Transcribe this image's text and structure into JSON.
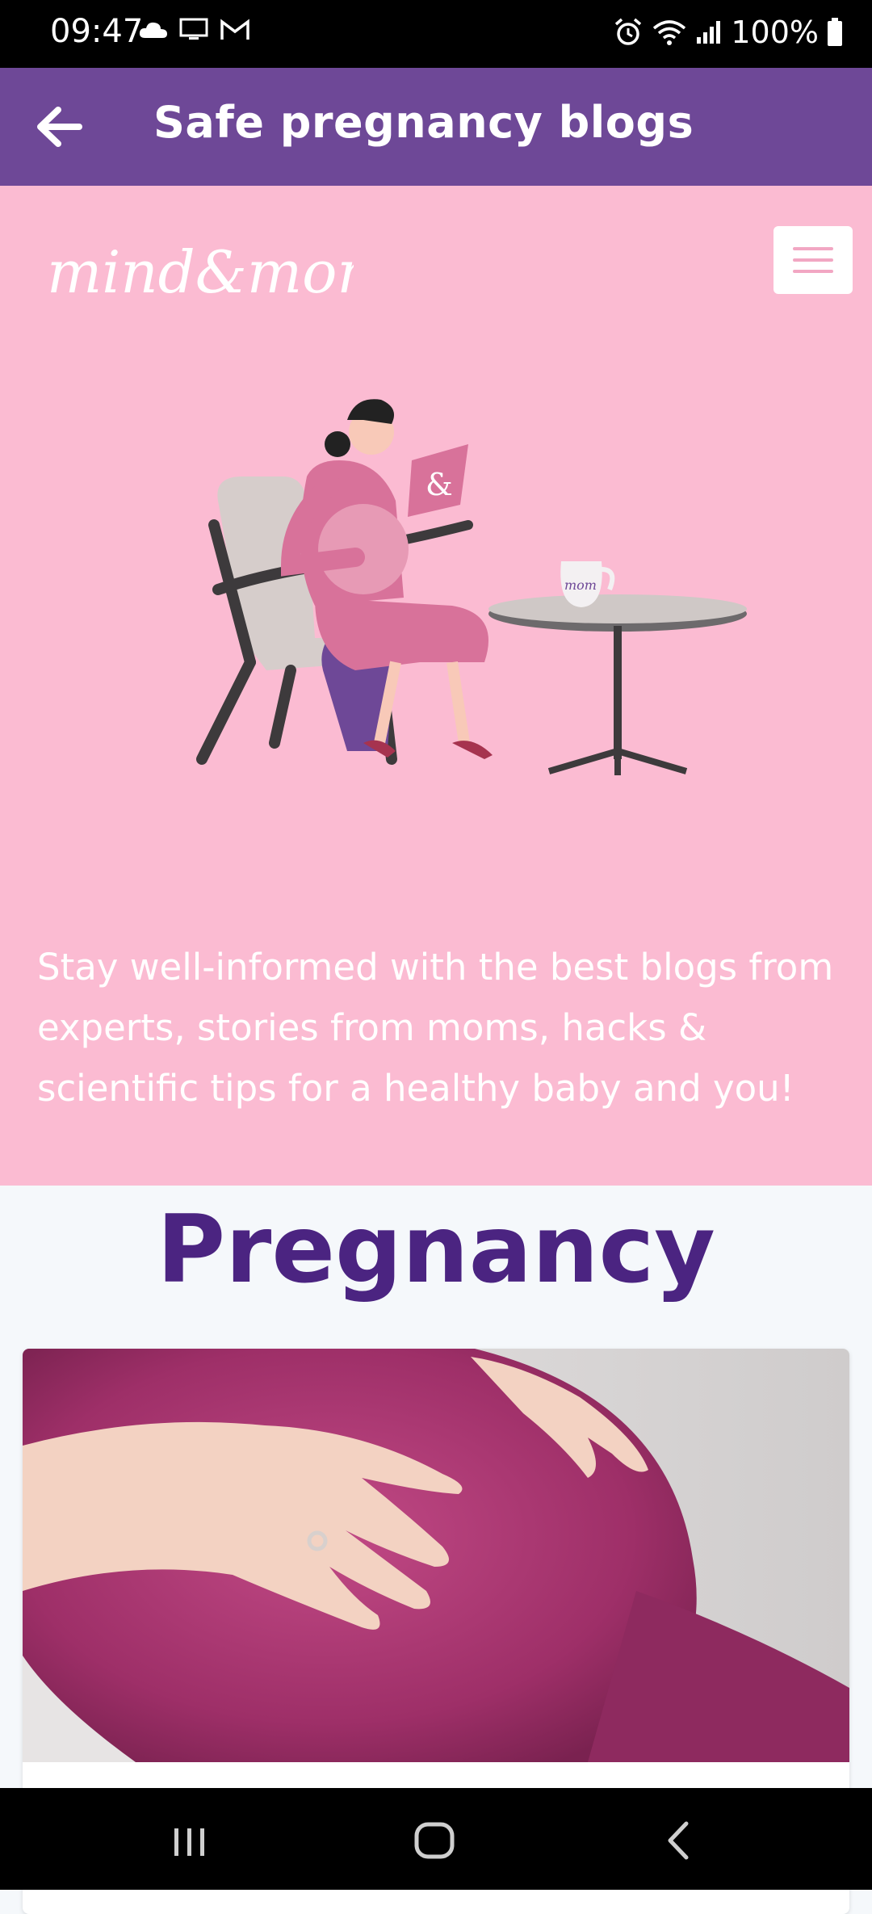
{
  "status_bar": {
    "time": "09:47",
    "battery": "100%",
    "left_icons": [
      "cloud-icon",
      "monitor-icon",
      "gmail-icon"
    ],
    "right_icons": [
      "alarm-icon",
      "wifi-icon",
      "signal-icon",
      "battery-icon"
    ]
  },
  "app_bar": {
    "title": "Safe pregnancy blogs",
    "back_icon": "arrow-left-icon",
    "color": "#6e4897"
  },
  "hero": {
    "logo_text": "mind&mom",
    "menu_icon": "hamburger-icon",
    "description": "Stay well-informed with the best blogs from experts, stories from moms, hacks & scientific tips for a healthy baby and you!",
    "background": "#fbbbd2"
  },
  "section": {
    "title": "Pregnancy",
    "title_color": "#4b2481"
  },
  "nav_bar": {
    "buttons": [
      "recents-icon",
      "home-icon",
      "back-icon"
    ]
  }
}
